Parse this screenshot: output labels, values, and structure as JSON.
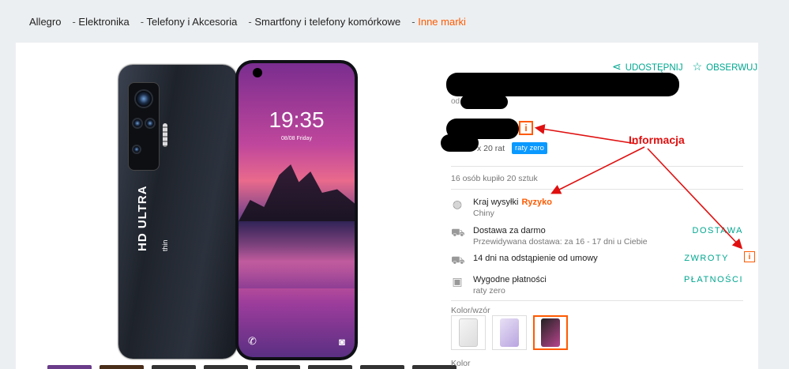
{
  "breadcrumb": [
    "Allegro",
    "Elektronika",
    "Telefony i Akcesoria",
    "Smartfony i telefony komórkowe",
    "Inne marki"
  ],
  "actions": {
    "share_label": "UDOSTĘPNIJ",
    "watch_label": "OBSERWUJ"
  },
  "seller_prefix": "od",
  "price_installments_text": "x 20 rat",
  "raty_badge": "raty zero",
  "annotation_label": "Informacja",
  "sold_text": "16 osób kupiło 20 sztuk",
  "info_rows": [
    {
      "title": "Kraj wysyłki",
      "badge": "Ryzyko",
      "sub": "Chiny",
      "icon": "globe-icon"
    },
    {
      "title": "Dostawa za darmo",
      "sub": "Przewidywana dostawa: za 16 - 17 dni u Ciebie",
      "link": "DOSTAWA",
      "icon": "truck-icon"
    },
    {
      "title": "14 dni na odstąpienie od umowy",
      "link": "ZWROTY",
      "icon": "return-truck-icon"
    },
    {
      "title": "Wygodne płatności",
      "sub": "raty zero",
      "link": "PŁATNOŚCI",
      "icon": "payment-icon"
    }
  ],
  "phone_image": {
    "time": "19:35",
    "date": "08/08 Friday",
    "brand": "HD ULTRA",
    "brand_sub": "thin"
  },
  "variant_label": "Kolor/wzór",
  "color_label": "Kolor",
  "colors": {
    "accent": "#ff5a00",
    "teal": "#00a790",
    "annotation": "#e01010",
    "badge_blue": "#0a99ff"
  }
}
